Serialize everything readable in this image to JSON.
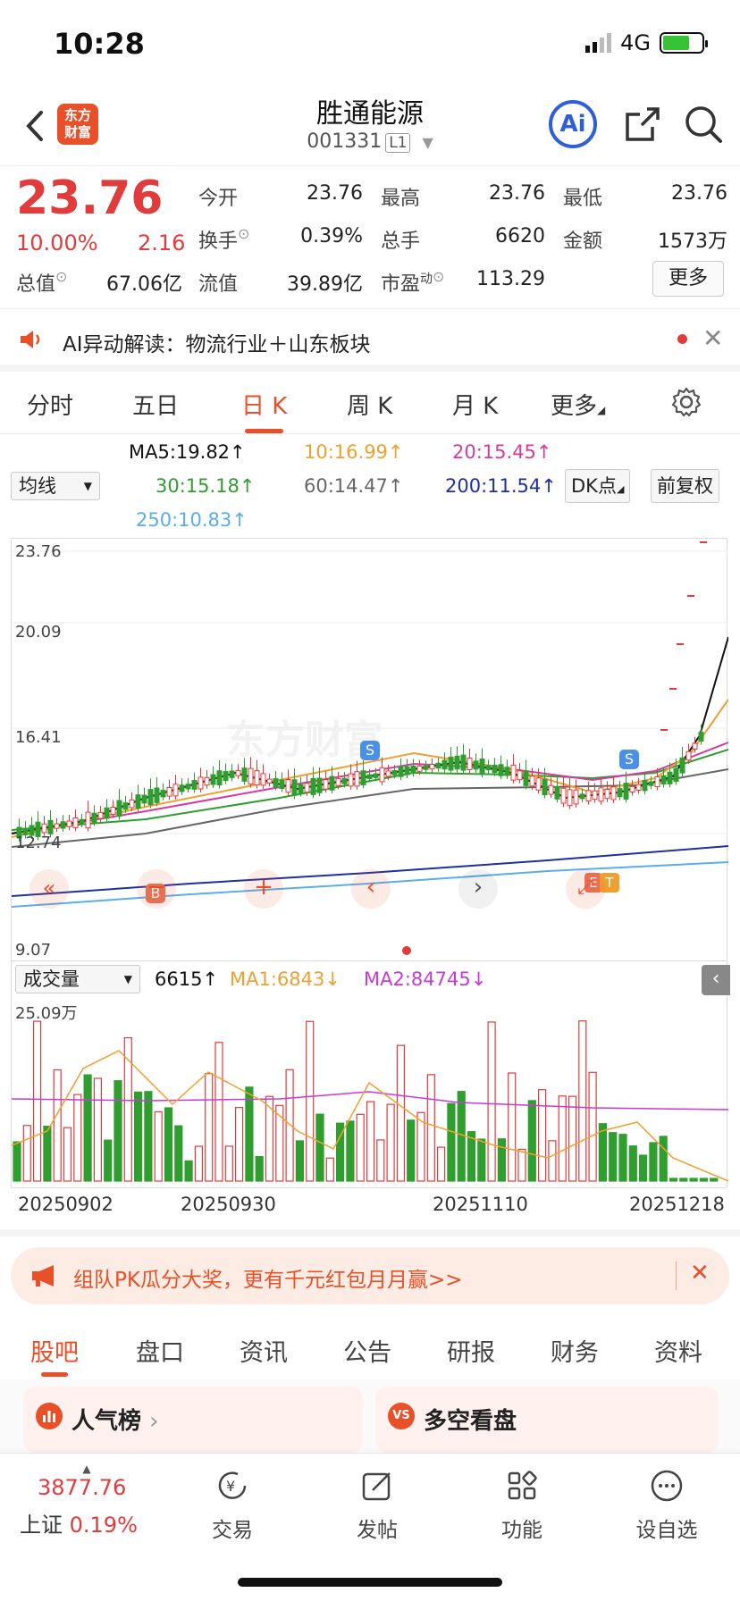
{
  "status": {
    "time": "10:28",
    "network": "4G"
  },
  "header": {
    "title": "胜通能源",
    "code": "001331",
    "level": "L1",
    "logo": "东方\n财富",
    "ai": "Ai"
  },
  "quote": {
    "price": "23.76",
    "pct": "10.00%",
    "change": "2.16",
    "open_label": "今开",
    "open": "23.76",
    "high_label": "最高",
    "high": "23.76",
    "low_label": "最低",
    "low": "23.76",
    "turnover_label": "换手",
    "turnover": "0.39%",
    "volume_label": "总手",
    "volume": "6620",
    "amount_label": "金额",
    "amount": "1573万",
    "mktcap_label": "总值",
    "mktcap": "67.06亿",
    "float_label": "流值",
    "float": "39.89亿",
    "pe_label": "市盈",
    "pe_sup": "动",
    "pe": "113.29",
    "more": "更多"
  },
  "ai_note": {
    "text": "AI异动解读：物流行业＋山东板块"
  },
  "tabs": [
    {
      "label": "分时"
    },
    {
      "label": "五日"
    },
    {
      "label": "日 K"
    },
    {
      "label": "周 K"
    },
    {
      "label": "月 K"
    },
    {
      "label": "更多"
    }
  ],
  "ma": {
    "selector": "均线",
    "ma5": "MA5:19.82",
    "ma10": "10:16.99",
    "ma20": "20:15.45",
    "ma30": "30:15.18",
    "ma60": "60:14.47",
    "ma200": "200:11.54",
    "ma250": "250:10.83",
    "dk": "DK点",
    "adj": "前复权"
  },
  "colors": {
    "ma5": "#111111",
    "ma10": "#f0a030",
    "ma20": "#d63aa0",
    "ma30": "#2f9e2f",
    "ma60": "#666666",
    "ma200": "#1e2fa0",
    "ma250": "#5aaee8",
    "up": "#e23b3b",
    "down": "#2f9e2f",
    "accent": "#e8502a"
  },
  "chart_labels": {
    "y_ticks": [
      "23.76",
      "20.09",
      "16.41",
      "12.74",
      "9.07"
    ],
    "watermark": "东方财富",
    "b": "B",
    "s": "S",
    "e": "E",
    "t": "T"
  },
  "volume": {
    "selector": "成交量",
    "v": "6615",
    "ma1": "MA1:6843",
    "ma2": "MA2:84745",
    "max_label": "25.09万"
  },
  "dates": [
    "20250902",
    "20250930",
    "20251110",
    "20251218"
  ],
  "banner": {
    "text": "组队PK瓜分大奖，更有千元红包月月赢>>"
  },
  "bottom_tabs": [
    {
      "label": "股吧"
    },
    {
      "label": "盘口"
    },
    {
      "label": "资讯"
    },
    {
      "label": "公告"
    },
    {
      "label": "研报"
    },
    {
      "label": "财务"
    },
    {
      "label": "资料"
    }
  ],
  "cards": {
    "left": "人气榜",
    "right": "多空看盘",
    "vs": "VS"
  },
  "bottom_nav": {
    "index_value": "3877.76",
    "index_name": "上证",
    "index_pct": "0.19%",
    "trade": "交易",
    "post": "发帖",
    "func": "功能",
    "watch": "设自选"
  }
}
